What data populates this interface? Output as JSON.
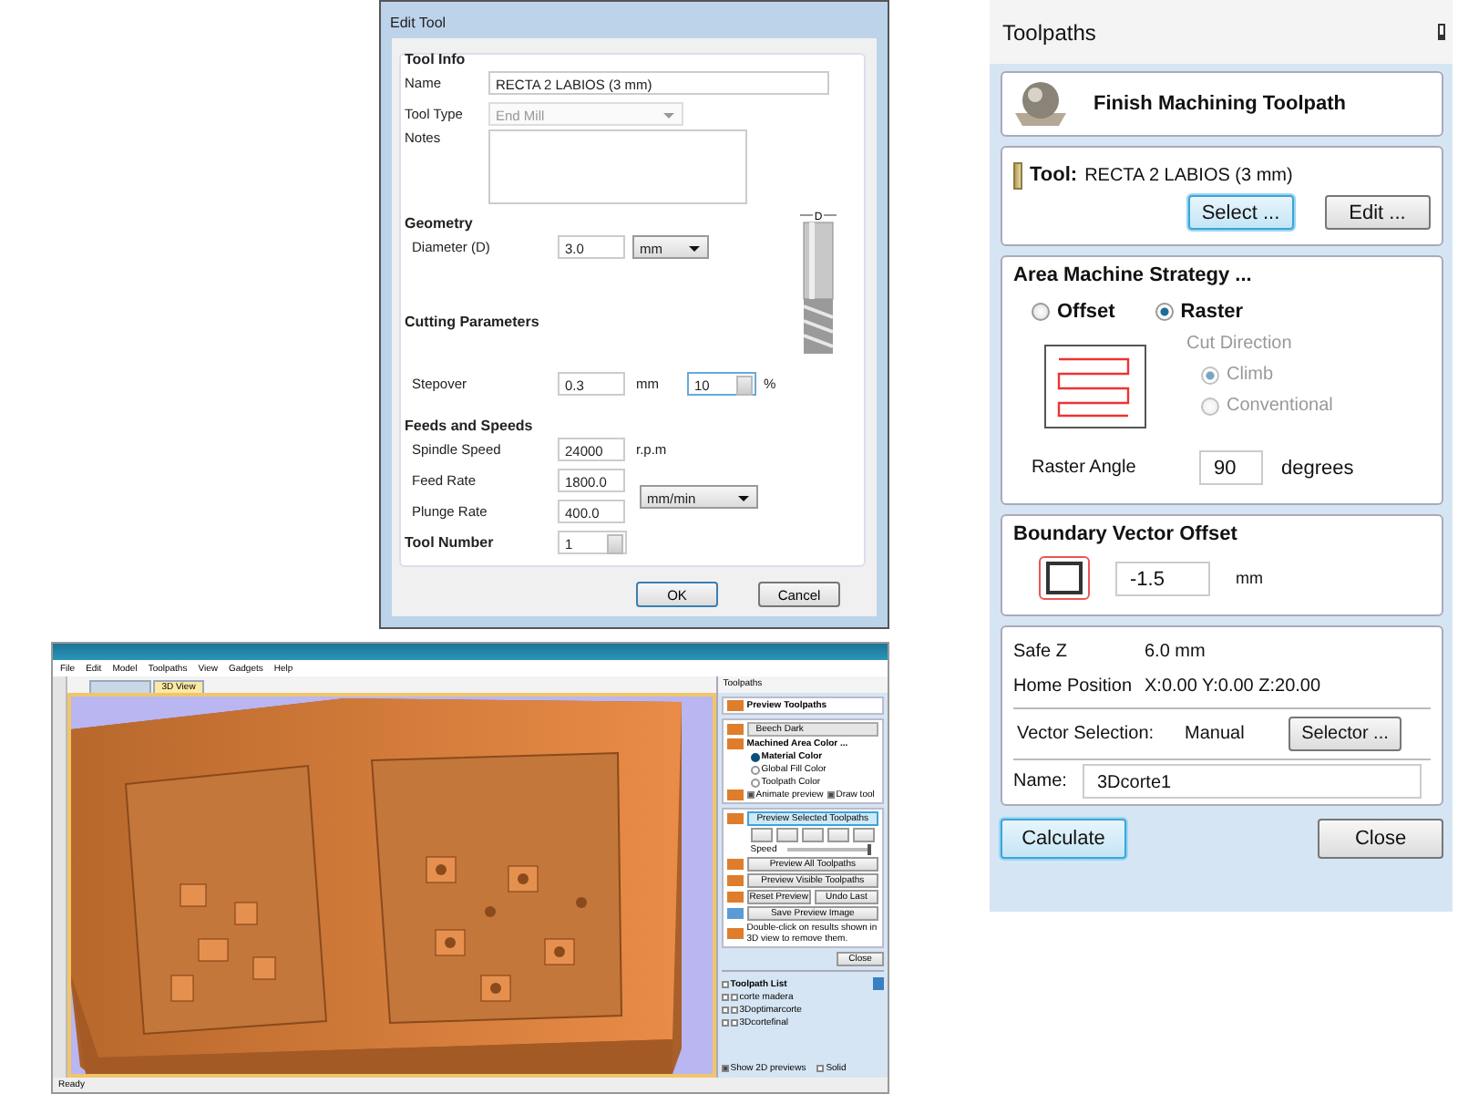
{
  "edit_tool": {
    "title": "Edit Tool",
    "tool_info_heading": "Tool Info",
    "name_label": "Name",
    "name_value": "RECTA 2 LABIOS (3 mm)",
    "tool_type_label": "Tool Type",
    "tool_type_value": "End Mill",
    "tool_type_disabled": true,
    "notes_label": "Notes",
    "geometry_heading": "Geometry",
    "diameter_label": "Diameter (D)",
    "diameter_value": "3.0",
    "diameter_unit": "mm",
    "diagram_label": "D",
    "cutting_heading": "Cutting Parameters",
    "stepover_label": "Stepover",
    "stepover_value": "0.3",
    "stepover_unit": "mm",
    "stepover_percent": "10",
    "percent_sign": "%",
    "feeds_heading": "Feeds and Speeds",
    "spindle_label": "Spindle Speed",
    "spindle_value": "24000",
    "spindle_unit": "r.p.m",
    "feed_label": "Feed Rate",
    "feed_value": "1800.0",
    "plunge_label": "Plunge Rate",
    "plunge_value": "400.0",
    "rate_unit": "mm/min",
    "tool_number_label": "Tool Number",
    "tool_number_value": "1",
    "ok_button": "OK",
    "cancel_button": "Cancel"
  },
  "toolpaths": {
    "title": "Toolpaths",
    "header": "Finish Machining Toolpath",
    "tool_label": "Tool:",
    "tool_name": "RECTA 2 LABIOS (3 mm)",
    "select_button": "Select ...",
    "edit_button": "Edit ...",
    "strategy_heading": "Area Machine Strategy ...",
    "strategies": [
      {
        "label": "Offset",
        "selected": false
      },
      {
        "label": "Raster",
        "selected": true
      }
    ],
    "cut_direction_label": "Cut Direction",
    "cut_direction_disabled": true,
    "cut_directions": [
      {
        "label": "Climb",
        "selected": true
      },
      {
        "label": "Conventional",
        "selected": false
      }
    ],
    "raster_angle_label": "Raster Angle",
    "raster_angle_value": "90",
    "raster_angle_unit": "degrees",
    "boundary_heading": "Boundary Vector Offset",
    "boundary_value": "-1.5",
    "boundary_unit": "mm",
    "safe_z_label": "Safe Z",
    "safe_z_value": "6.0 mm",
    "home_label": "Home Position",
    "home_value": "X:0.00 Y:0.00 Z:20.00",
    "vector_selection_label": "Vector Selection:",
    "vector_selection_value": "Manual",
    "selector_button": "Selector ...",
    "name_label": "Name:",
    "name_value": "3Dcorte1",
    "calculate_button": "Calculate",
    "close_button": "Close"
  },
  "app": {
    "menu": [
      "File",
      "Edit",
      "Model",
      "Toolpaths",
      "View",
      "Gadgets",
      "Help"
    ],
    "tabs": [
      {
        "label": "3D View",
        "selected": true
      }
    ],
    "panel": {
      "title": "Toolpaths",
      "preview_heading": "Preview Toolpaths",
      "material": "Beech Dark",
      "machined_heading": "Machined Area Color ...",
      "color_options": [
        {
          "label": "Material Color",
          "selected": true
        },
        {
          "label": "Global Fill Color",
          "selected": false
        },
        {
          "label": "Toolpath Color",
          "selected": false
        }
      ],
      "options": [
        {
          "label": "Animate preview",
          "checked": true
        },
        {
          "label": "Draw tool",
          "checked": true
        }
      ],
      "preview_selected_button": "Preview Selected Toolpaths",
      "speed_label": "Speed",
      "speed": {
        "level": 0.97
      },
      "preview_all_button": "Preview All Toolpaths",
      "preview_visible_button": "Preview Visible Toolpaths",
      "reset_button": "Reset Preview",
      "undo_button": "Undo Last",
      "save_button": "Save Preview Image",
      "note": "Double-click on results shown in 3D view to remove them.",
      "close_button": "Close",
      "list_heading": "Toolpath List",
      "list_checked": false,
      "toolpaths": [
        {
          "name": "corte madera",
          "checked": false
        },
        {
          "name": "3Doptimarcorte",
          "checked": false
        },
        {
          "name": "3Dcortefinal",
          "checked": false
        }
      ],
      "show_2d": {
        "label": "Show 2D previews",
        "checked": true
      },
      "solid": {
        "label": "Solid",
        "checked": false
      }
    },
    "status": "Ready"
  }
}
